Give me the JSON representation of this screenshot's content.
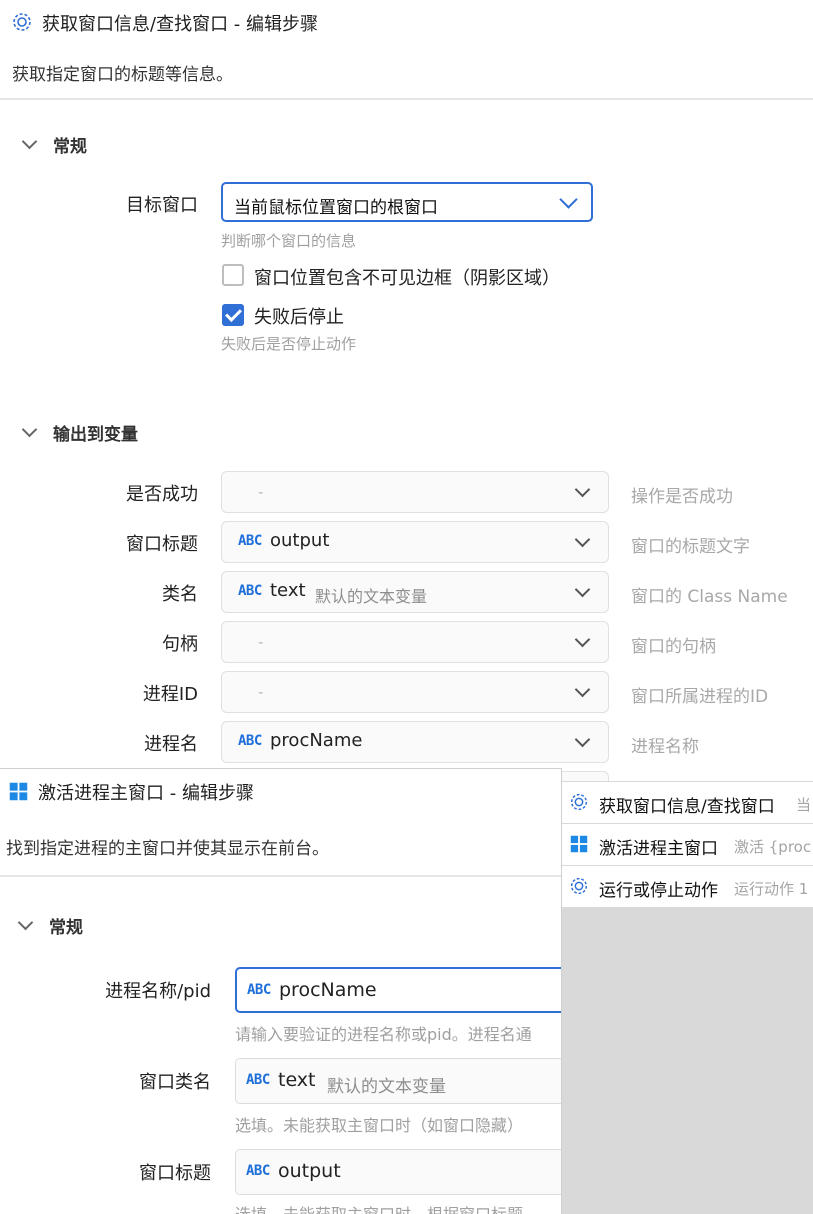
{
  "window_back": {
    "title": "获取窗口信息/查找窗口 - 编辑步骤",
    "description": "获取指定窗口的标题等信息。",
    "general": {
      "header": "常规",
      "target_label": "目标窗口",
      "target_value": "当前鼠标位置窗口的根窗口",
      "target_hint": "判断哪个窗口的信息",
      "invisible_border_label": "窗口位置包含不可见边框（阴影区域）",
      "stop_on_fail_label": "失败后停止",
      "stop_on_fail_hint": "失败后是否停止动作"
    },
    "output": {
      "header": "输出到变量",
      "rows": [
        {
          "label": "是否成功",
          "type": "",
          "value": "-",
          "desc": "",
          "hint": "操作是否成功"
        },
        {
          "label": "窗口标题",
          "type": "ABC",
          "value": "output",
          "desc": "",
          "hint": "窗口的标题文字"
        },
        {
          "label": "类名",
          "type": "ABC",
          "value": "text",
          "desc": "默认的文本变量",
          "hint": "窗口的 Class Name"
        },
        {
          "label": "句柄",
          "type": "",
          "value": "-",
          "desc": "",
          "hint": "窗口的句柄"
        },
        {
          "label": "进程ID",
          "type": "",
          "value": "-",
          "desc": "",
          "hint": "窗口所属进程的ID"
        },
        {
          "label": "进程名",
          "type": "ABC",
          "value": "procName",
          "desc": "",
          "hint": "进程名称"
        }
      ]
    }
  },
  "step_list": [
    {
      "name": "获取窗口信息/查找窗口",
      "desc": "当",
      "icon": "gear-icon"
    },
    {
      "name": "激活进程主窗口",
      "desc": "激活 {proc",
      "icon": "windows-icon"
    },
    {
      "name": "运行或停止动作",
      "desc": "运行动作 1",
      "icon": "gear-icon"
    }
  ],
  "window_front": {
    "title": "激活进程主窗口 - 编辑步骤",
    "description": "找到指定进程的主窗口并使其显示在前台。",
    "general_header": "常规",
    "fields": [
      {
        "label": "进程名称/pid",
        "type": "ABC",
        "value": "procName",
        "desc": "",
        "hint": "请输入要验证的进程名称或pid。进程名通"
      },
      {
        "label": "窗口类名",
        "type": "ABC",
        "value": "text",
        "desc": "默认的文本变量",
        "hint": "选填。未能获取主窗口时（如窗口隐藏）"
      },
      {
        "label": "窗口标题",
        "type": "ABC",
        "value": "output",
        "desc": "",
        "hint": "选填。未能获取主窗口时，根据窗口标题"
      }
    ]
  },
  "colors": {
    "accent": "#2f6fd6",
    "abc": "#1e6fd9",
    "hint": "#a0a0a0"
  }
}
